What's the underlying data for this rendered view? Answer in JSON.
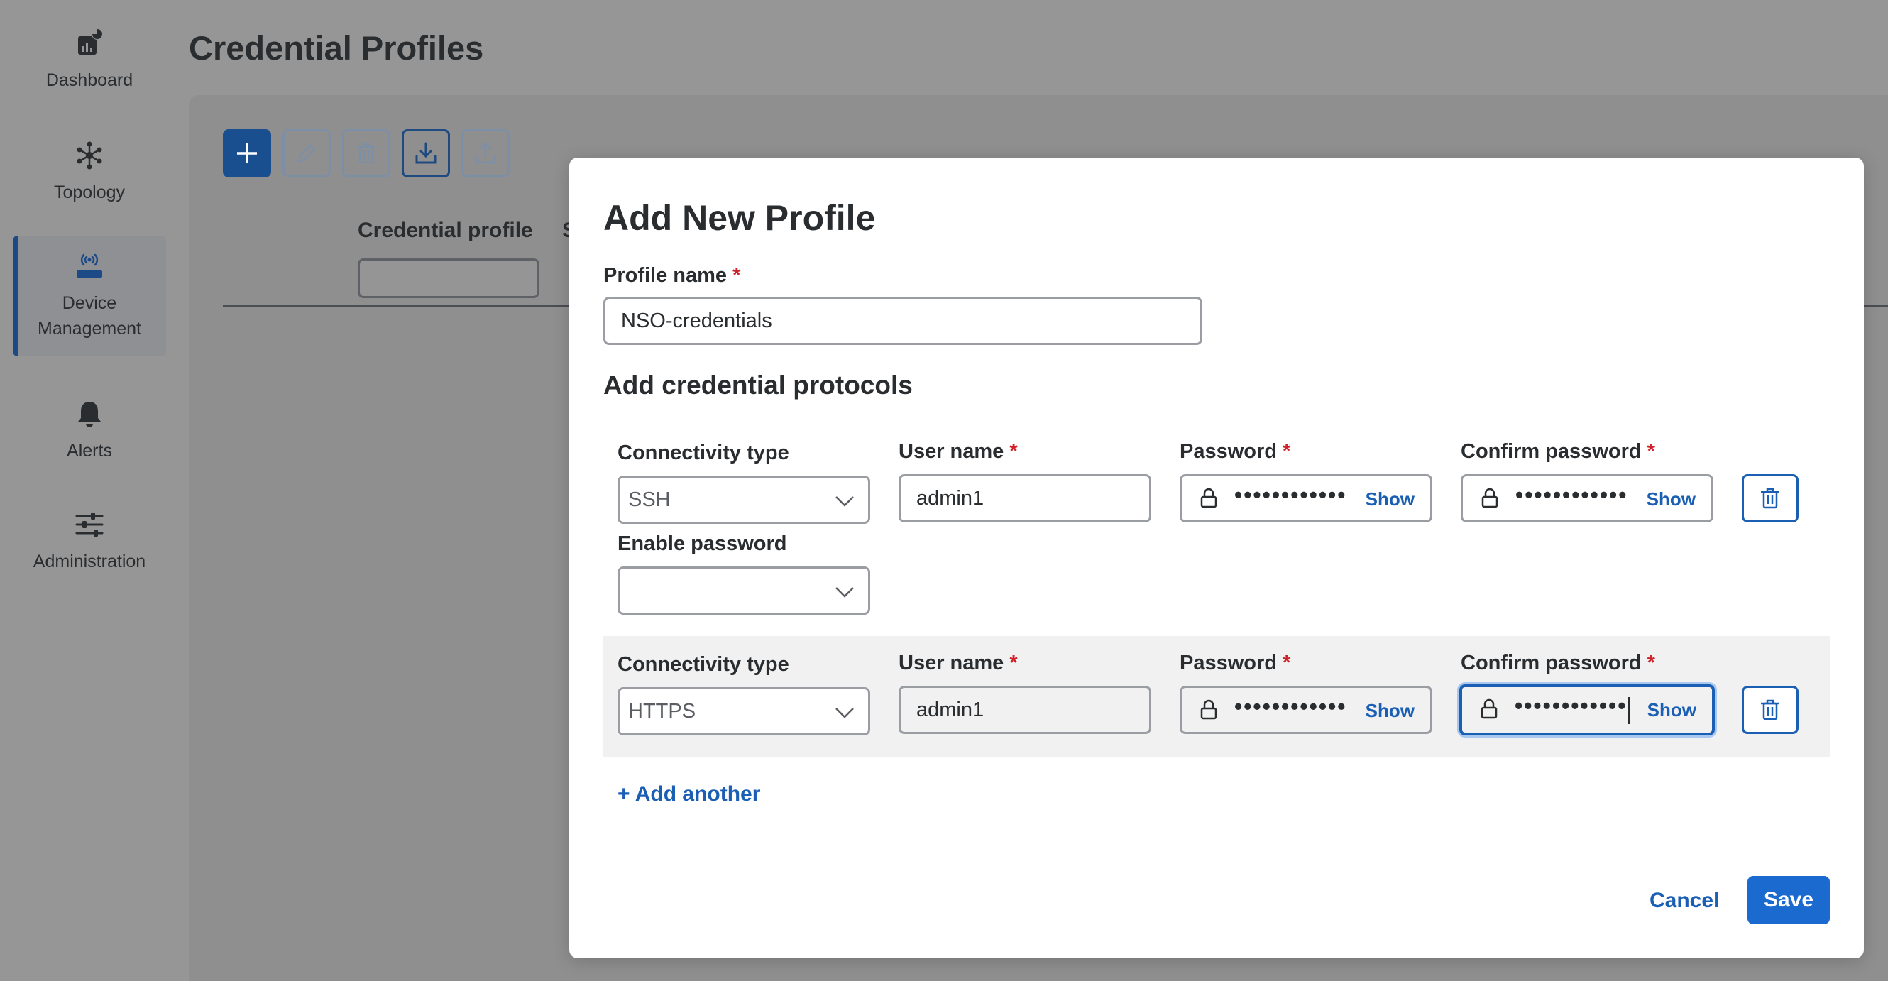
{
  "sidebar": {
    "items": [
      {
        "label": "Dashboard",
        "icon": "dashboard-icon"
      },
      {
        "label": "Topology",
        "icon": "topology-icon"
      },
      {
        "label_line1": "Device",
        "label_line2": "Management",
        "icon": "device-management-icon",
        "active": true
      },
      {
        "label": "Alerts",
        "icon": "bell-icon"
      },
      {
        "label": "Administration",
        "icon": "sliders-icon"
      }
    ]
  },
  "page": {
    "title": "Credential Profiles",
    "toolbar": {
      "buttons": [
        {
          "name": "add",
          "icon": "plus-icon"
        },
        {
          "name": "edit",
          "icon": "pencil-icon"
        },
        {
          "name": "delete",
          "icon": "trash-icon"
        },
        {
          "name": "import",
          "icon": "download-icon"
        },
        {
          "name": "export",
          "icon": "upload-icon"
        }
      ]
    },
    "table": {
      "columns": [
        "Credential profile",
        "S"
      ]
    }
  },
  "modal": {
    "title": "Add New Profile",
    "profile_name_label": "Profile name",
    "required_mark": "*",
    "profile_name_value": "NSO-credentials",
    "section_title": "Add credential protocols",
    "labels": {
      "connectivity_type": "Connectivity type",
      "user_name": "User name",
      "password": "Password",
      "confirm_password": "Confirm password",
      "enable_password": "Enable password",
      "show": "Show"
    },
    "protocols": [
      {
        "connectivity_type": "SSH",
        "user_name": "admin1",
        "password_mask": "••••••••••••",
        "confirm_mask": "••••••••••••",
        "enable_password": ""
      },
      {
        "connectivity_type": "HTTPS",
        "user_name": "admin1",
        "password_mask": "••••••••••••",
        "confirm_mask": "••••••••••••",
        "confirm_focused": true
      }
    ],
    "add_another": "+ Add another",
    "cancel": "Cancel",
    "save": "Save"
  },
  "colors": {
    "accent": "#1b5fb5",
    "primary_button": "#1b6ad0",
    "required": "#d0222b",
    "overlay": "#969696"
  }
}
